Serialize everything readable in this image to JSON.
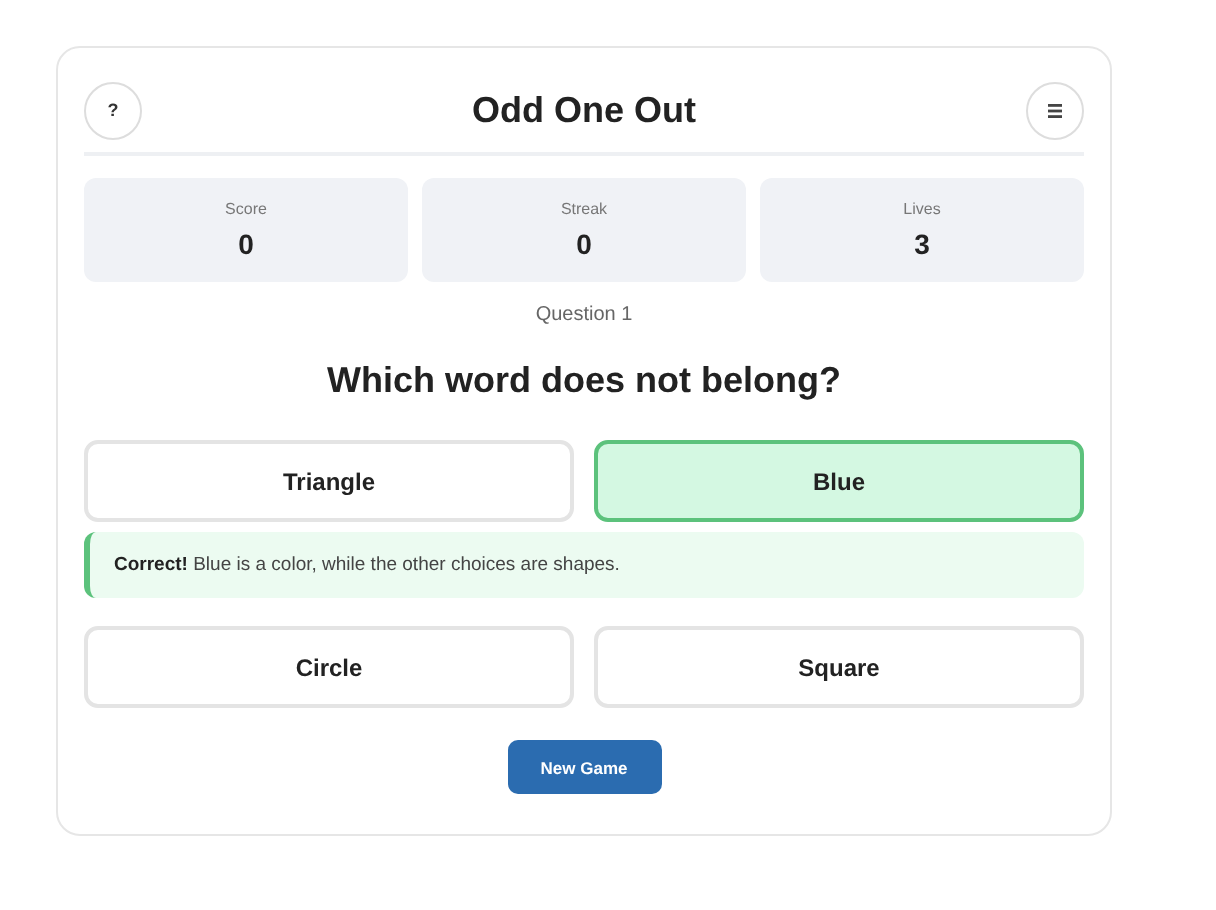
{
  "header": {
    "help_button": "?",
    "title": "Odd One Out"
  },
  "stats": [
    {
      "label": "Score",
      "value": "0"
    },
    {
      "label": "Streak",
      "value": "0"
    },
    {
      "label": "Lives",
      "value": "3"
    }
  ],
  "question_number": "Question 1",
  "question": "Which word does not belong?",
  "options": [
    {
      "label": "Triangle",
      "correct": false
    },
    {
      "label": "Blue",
      "correct": true
    },
    {
      "label": "Circle",
      "correct": false
    },
    {
      "label": "Square",
      "correct": false
    }
  ],
  "feedback": {
    "kind": "correct",
    "text": "**Correct!** Blue is a color, while the other choices are shapes."
  },
  "new_game_button": "New Game"
}
